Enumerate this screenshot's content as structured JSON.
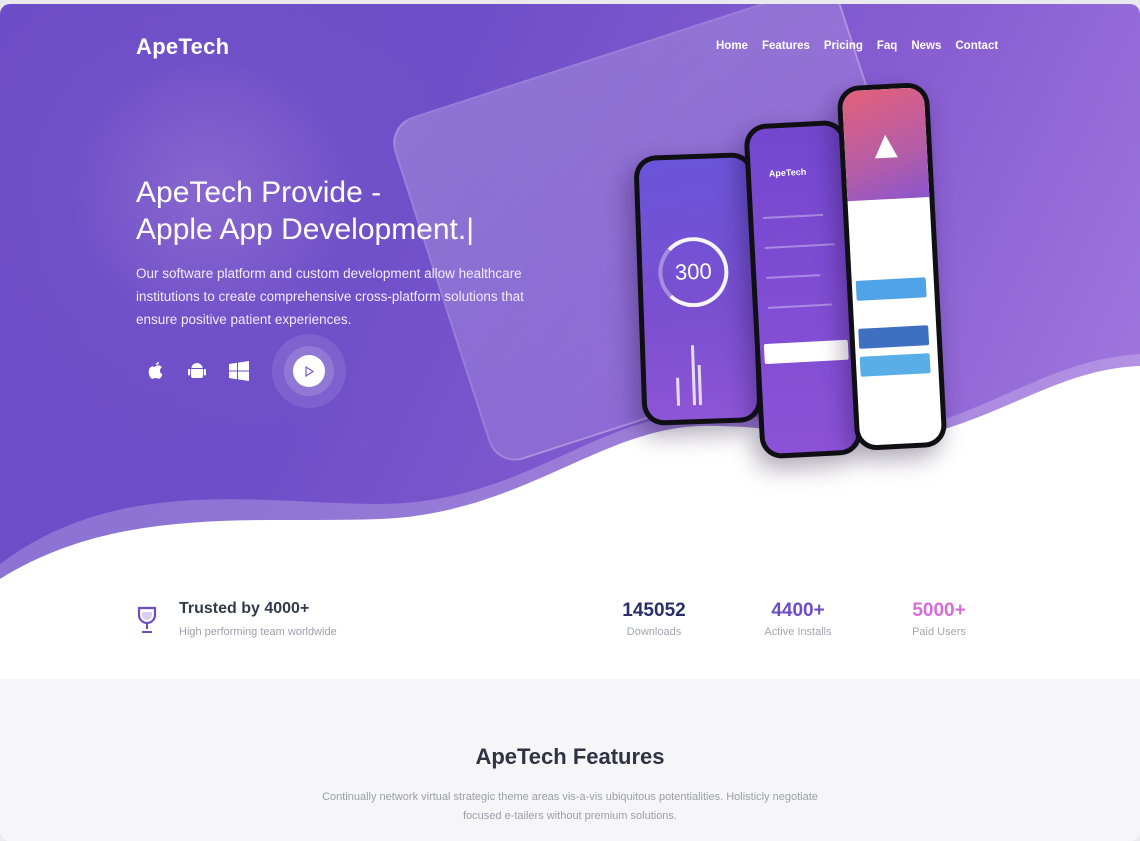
{
  "brand": {
    "name": "ApeTech"
  },
  "nav": {
    "items": [
      "Home",
      "Features",
      "Pricing",
      "Faq",
      "News",
      "Contact"
    ]
  },
  "hero": {
    "title_line1": "ApeTech Provide -",
    "title_line2": "Apple App Development.",
    "title_cursor": "|",
    "description": "Our software platform and custom development allow healthcare institutions to create comprehensive cross-platform solutions that ensure positive patient experiences.",
    "platform_icons": [
      "apple-icon",
      "android-icon",
      "windows-icon"
    ],
    "play_icon": "play-icon"
  },
  "phones": {
    "dial_value": "300",
    "app_brand": "ApeTech"
  },
  "trusted": {
    "title": "Trusted by 4000+",
    "subtitle": "High performing team worldwide",
    "icon": "trophy-icon"
  },
  "stats": [
    {
      "value": "145052",
      "label": "Downloads",
      "color": "#2a2f6b"
    },
    {
      "value": "4400+",
      "label": "Active Installs",
      "color": "#6e4cc4"
    },
    {
      "value": "5000+",
      "label": "Paid Users",
      "color": "#d66cd8"
    }
  ],
  "features": {
    "title": "ApeTech Features",
    "description": "Continually network virtual strategic theme areas vis-a-vis ubiquitous potentialities. Holisticly negotiate focused e-tailers without premium solutions."
  },
  "colors": {
    "hero_start": "#6c4bc7",
    "hero_end": "#a57be0",
    "accent": "#6e4cc4"
  }
}
